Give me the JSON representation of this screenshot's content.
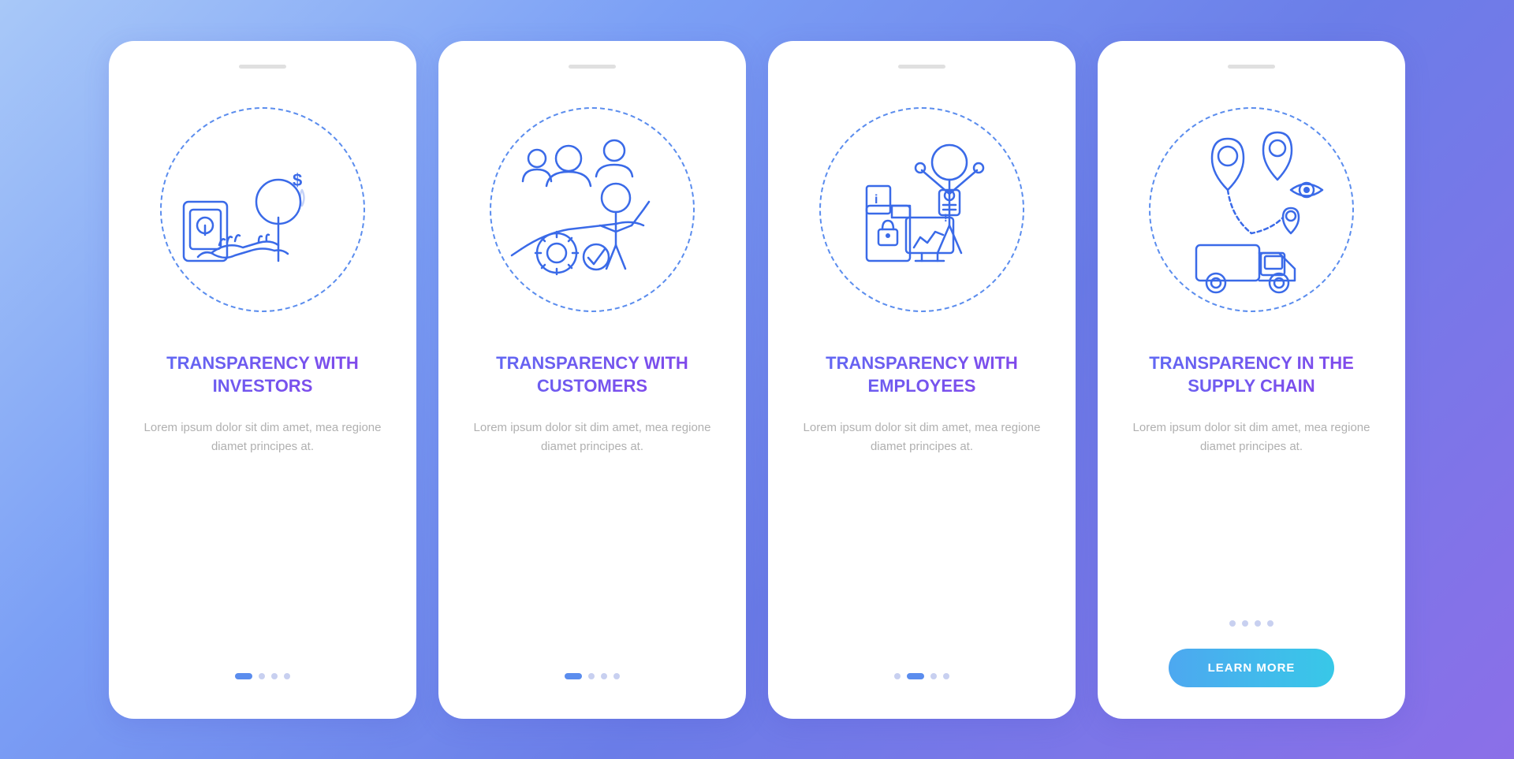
{
  "background": {
    "gradient_start": "#a8c8f8",
    "gradient_end": "#8b6fe8"
  },
  "cards": [
    {
      "id": "card-investors",
      "title": "TRANSPARENCY WITH INVESTORS",
      "body_text": "Lorem ipsum dolor sit dim amet, mea regione diamet principes at.",
      "dots": [
        true,
        false,
        false,
        false
      ],
      "active_dot": 0,
      "show_button": false,
      "illustration": "investors"
    },
    {
      "id": "card-customers",
      "title": "TRANSPARENCY WITH CUSTOMERS",
      "body_text": "Lorem ipsum dolor sit dim amet, mea regione diamet principes at.",
      "dots": [
        true,
        false,
        false,
        false
      ],
      "active_dot": 0,
      "show_button": false,
      "illustration": "customers"
    },
    {
      "id": "card-employees",
      "title": "TRANSPARENCY WITH EMPLOYEES",
      "body_text": "Lorem ipsum dolor sit dim amet, mea regione diamet principes at.",
      "dots": [
        false,
        true,
        false,
        false
      ],
      "active_dot": 1,
      "show_button": false,
      "illustration": "employees"
    },
    {
      "id": "card-supply",
      "title": "TRANSPARENCY IN THE SUPPLY CHAIN",
      "body_text": "Lorem ipsum dolor sit dim amet, mea regione diamet principes at.",
      "dots": [
        false,
        false,
        false,
        false
      ],
      "active_dot": -1,
      "show_button": true,
      "button_label": "LEARN MORE",
      "illustration": "supply"
    }
  ]
}
